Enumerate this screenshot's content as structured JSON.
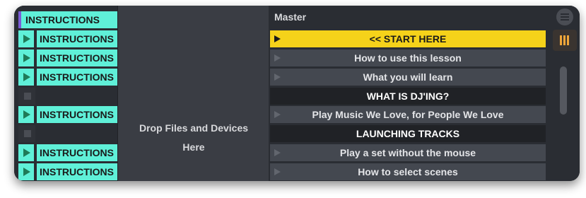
{
  "tracks": {
    "header": "INSTRUCTIONS",
    "slots": [
      {
        "label": "INSTRUCTIONS",
        "filled": true
      },
      {
        "label": "INSTRUCTIONS",
        "filled": true
      },
      {
        "label": "INSTRUCTIONS",
        "filled": true
      },
      {
        "label": "",
        "filled": false
      },
      {
        "label": "INSTRUCTIONS",
        "filled": true
      },
      {
        "label": "",
        "filled": false
      },
      {
        "label": "INSTRUCTIONS",
        "filled": true
      },
      {
        "label": "INSTRUCTIONS",
        "filled": true
      }
    ]
  },
  "drop_area": {
    "line1": "Drop Files and Devices",
    "line2": "Here"
  },
  "master": {
    "title": "Master",
    "scenes": [
      {
        "label": "<< START HERE",
        "kind": "active"
      },
      {
        "label": "How to use this lesson",
        "kind": "normal"
      },
      {
        "label": "What you will learn",
        "kind": "normal"
      },
      {
        "label": "WHAT IS DJ'ING?",
        "kind": "section"
      },
      {
        "label": "Play Music We Love, for People We Love",
        "kind": "normal"
      },
      {
        "label": "LAUNCHING TRACKS",
        "kind": "section"
      },
      {
        "label": "Play a set without the mouse",
        "kind": "normal"
      },
      {
        "label": "How to select scenes",
        "kind": "normal"
      }
    ]
  },
  "colors": {
    "clip": "#5ff0d8",
    "active_scene": "#f5d21a",
    "mixer_accent": "#f0a63a"
  },
  "icons": {
    "menu": "hamburger-menu-icon",
    "mixer": "mixer-bars-icon",
    "play": "play-triangle-icon",
    "stop": "stop-square-icon"
  }
}
